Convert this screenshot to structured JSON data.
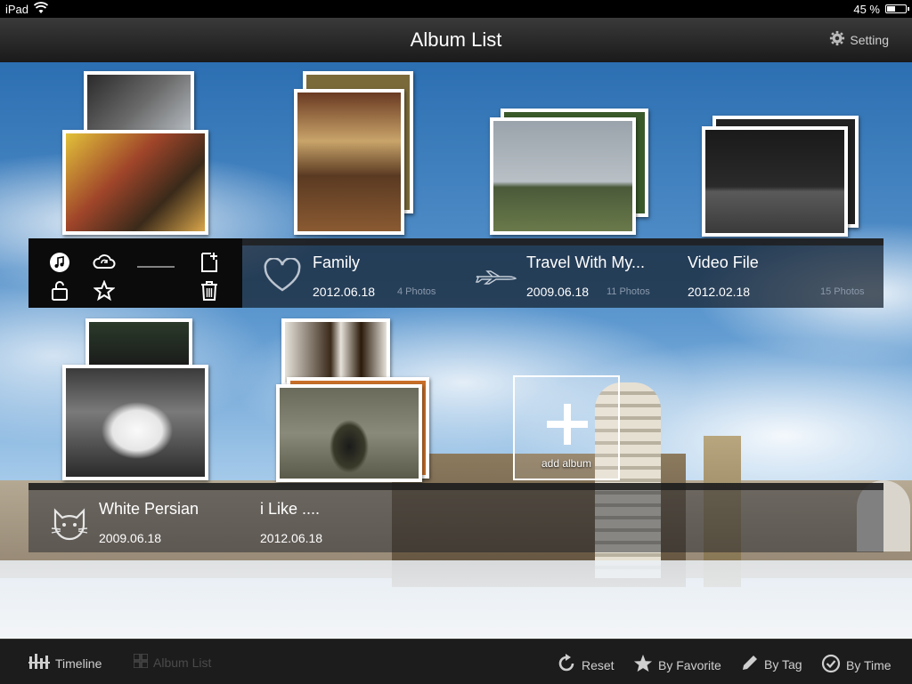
{
  "status": {
    "carrier": "iPad",
    "battery": "45 %",
    "battery_level": 0.45
  },
  "navbar": {
    "title": "Album List",
    "setting_label": "Setting"
  },
  "albums_row1": [
    {
      "name": "Family",
      "date": "2012.06.18",
      "count": "4 Photos",
      "icon": "heart-icon"
    },
    {
      "name": "Travel With My...",
      "date": "2009.06.18",
      "count": "11 Photos",
      "icon": "airplane-icon"
    },
    {
      "name": "Video File",
      "date": "2012.02.18",
      "count": "15 Photos"
    }
  ],
  "albums_row2": [
    {
      "name": "White Persian",
      "date": "2009.06.18",
      "count": "",
      "icon": "cat-icon"
    },
    {
      "name": "i Like ....",
      "date": "2012.06.18",
      "count": ""
    }
  ],
  "add_album": {
    "label": "add album"
  },
  "toolbar": {
    "timeline": "Timeline",
    "album_list": "Album List",
    "reset": "Reset",
    "by_favorite": "By Favorite",
    "by_tag": "By Tag",
    "by_time": "By Time"
  }
}
